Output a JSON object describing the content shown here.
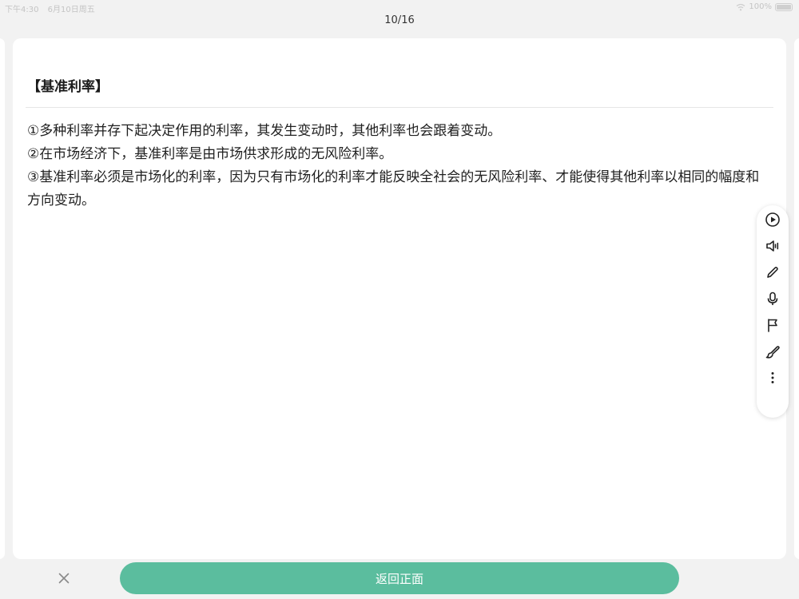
{
  "status_bar": {
    "time": "下午4:30",
    "date": "6月10日周五",
    "battery": "100%",
    "battery_level": 1.0
  },
  "page_counter": "10/16",
  "card": {
    "title": "【基准利率】",
    "lines": [
      "①多种利率并存下起决定作用的利率，其发生变动时，其他利率也会跟着变动。",
      "②在市场经济下，基准利率是由市场供求形成的无风险利率。",
      "③基准利率必须是市场化的利率，因为只有市场化的利率才能反映全社会的无风险利率、才能使得其他利率以相同的幅度和方向变动。"
    ]
  },
  "toolbar": {
    "items": [
      {
        "icon": "play-circle-icon"
      },
      {
        "icon": "speaker-icon"
      },
      {
        "icon": "pencil-icon"
      },
      {
        "icon": "microphone-icon"
      },
      {
        "icon": "flag-icon"
      },
      {
        "icon": "brush-icon"
      },
      {
        "icon": "more-vertical-icon"
      }
    ]
  },
  "bottom": {
    "close_icon": "close-icon",
    "back_label": "返回正面"
  },
  "colors": {
    "accent": "#5bbd9e",
    "background": "#f2f2f2",
    "card": "#ffffff"
  }
}
